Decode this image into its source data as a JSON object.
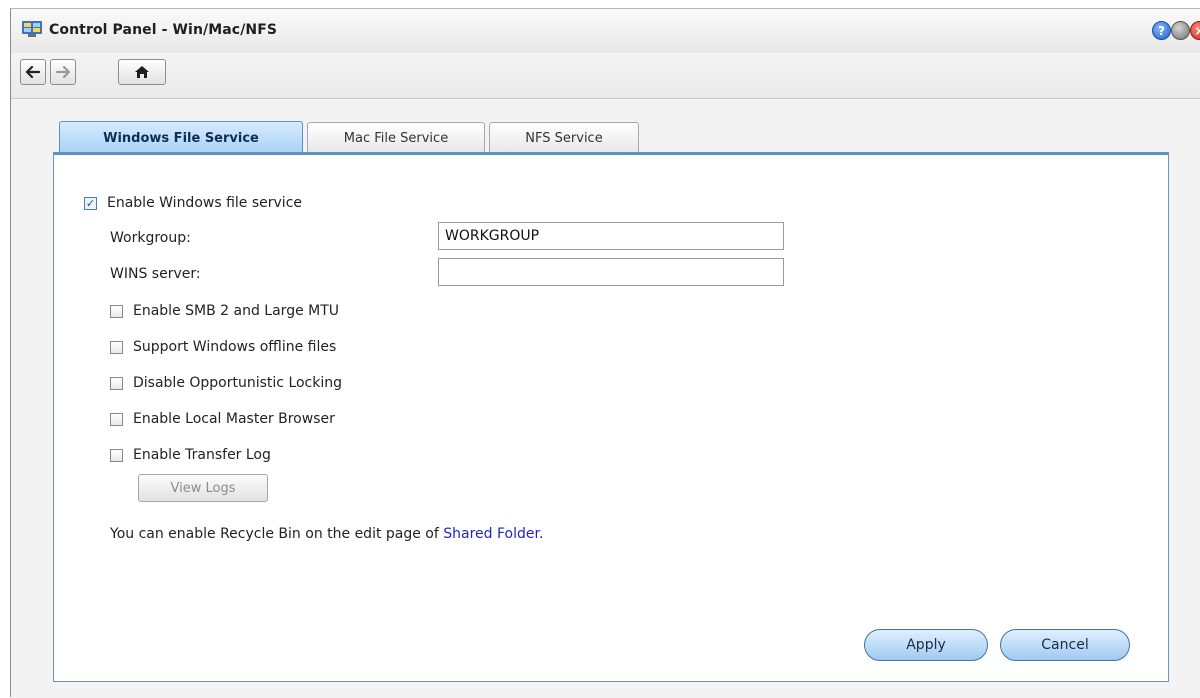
{
  "window": {
    "title": "Control Panel - Win/Mac/NFS"
  },
  "titlebar_buttons": [
    {
      "name": "help",
      "glyph": "?"
    },
    {
      "name": "minimize",
      "glyph": ""
    },
    {
      "name": "close",
      "glyph": "×"
    }
  ],
  "toolbar": {
    "back_icon": "arrow-left-icon",
    "forward_icon": "arrow-right-icon",
    "home_icon": "home-icon"
  },
  "tabs": [
    {
      "label": "Windows File Service",
      "active": true
    },
    {
      "label": "Mac File Service",
      "active": false
    },
    {
      "label": "NFS Service",
      "active": false
    }
  ],
  "form": {
    "enable_service": {
      "label": "Enable Windows file service",
      "checked": true
    },
    "workgroup": {
      "label": "Workgroup:",
      "value": "WORKGROUP"
    },
    "wins_server": {
      "label": "WINS server:",
      "value": ""
    },
    "options": [
      {
        "label": "Enable SMB 2 and Large MTU",
        "checked": false
      },
      {
        "label": "Support Windows offline files",
        "checked": false
      },
      {
        "label": "Disable Opportunistic Locking",
        "checked": false
      },
      {
        "label": "Enable Local Master Browser",
        "checked": false
      },
      {
        "label": "Enable Transfer Log",
        "checked": false
      }
    ],
    "view_logs_label": "View Logs",
    "note_prefix": "You can enable Recycle Bin on the edit page of ",
    "note_link": "Shared Folder",
    "note_suffix": "."
  },
  "actions": {
    "apply_label": "Apply",
    "cancel_label": "Cancel"
  },
  "colors": {
    "accent": "#5c93c7",
    "link": "#2323c7",
    "checked_mark": "#1e4f8a"
  }
}
